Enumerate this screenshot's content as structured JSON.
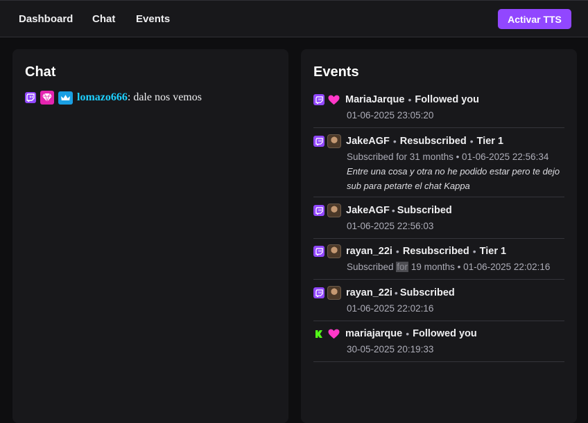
{
  "nav": {
    "dashboard": "Dashboard",
    "chat": "Chat",
    "events": "Events",
    "tts_button": "Activar TTS"
  },
  "chat_panel": {
    "title": "Chat",
    "messages": [
      {
        "badges": [
          "twitch-icon",
          "subscriber-gem-icon",
          "crown-icon"
        ],
        "user": "lomazo666",
        "separator": ":",
        "text": " dale nos vemos",
        "user_color": "#1ed0ff"
      }
    ]
  },
  "events_panel": {
    "title": "Events",
    "items": [
      {
        "platform": "twitch",
        "icon": "heart-icon",
        "user": "MariaJarque",
        "sep": "•",
        "type": "Followed you",
        "meta": "01-06-2025 23:05:20"
      },
      {
        "platform": "twitch",
        "icon": "avatar",
        "user": "JakeAGF",
        "sep": "•",
        "type": "Resubscribed",
        "sep2": "•",
        "tier": "Tier 1",
        "meta": "Subscribed for 31 months • 01-06-2025 22:56:34",
        "message": "Entre una cosa y otra no he podido estar pero te dejo sub para petarte el chat Kappa"
      },
      {
        "platform": "twitch",
        "icon": "avatar",
        "user": "JakeAGF",
        "sep": "•",
        "type": "Subscribed",
        "meta": "01-06-2025 22:56:03"
      },
      {
        "platform": "twitch",
        "icon": "avatar",
        "user": "rayan_22i",
        "sep": "•",
        "type": "Resubscribed",
        "sep2": "•",
        "tier": "Tier 1",
        "meta_a": "Subscribed ",
        "meta_hl": "for",
        "meta_b": " 19 months • 01-06-2025 22:02:16"
      },
      {
        "platform": "twitch",
        "icon": "avatar",
        "user": "rayan_22i",
        "sep": "•",
        "type": "Subscribed",
        "meta": "01-06-2025 22:02:16"
      },
      {
        "platform": "kick",
        "icon": "heart-icon",
        "user": "mariajarque",
        "sep": "•",
        "type": "Followed you",
        "meta": "30-05-2025 20:19:33"
      }
    ]
  },
  "colors": {
    "accent": "#9147ff",
    "heart": "#ff38c8",
    "kick": "#53fc18",
    "chat_user": "#1ed0ff"
  }
}
